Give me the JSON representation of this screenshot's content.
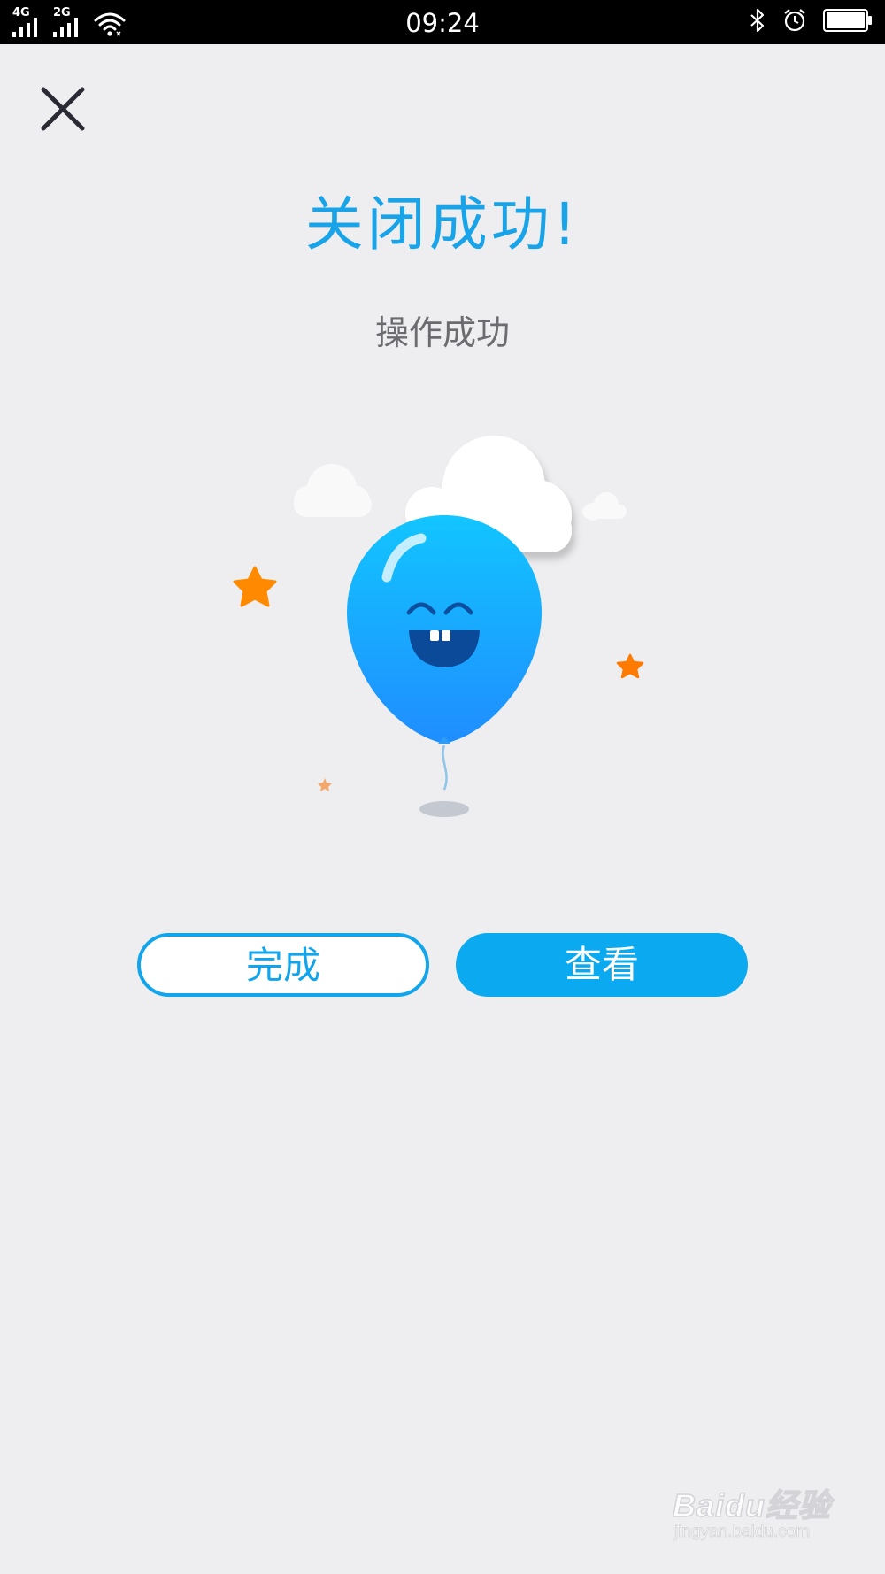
{
  "status_bar": {
    "network_1": "4G",
    "network_2": "2G",
    "time": "09:24",
    "icons": [
      "signal-icon",
      "signal-icon",
      "wifi-icon",
      "bluetooth-icon",
      "alarm-icon",
      "battery-icon"
    ]
  },
  "dialog": {
    "title": "关闭成功!",
    "subtitle": "操作成功",
    "close_icon": "close-icon",
    "illustration": "smiling-balloon-illustration"
  },
  "buttons": {
    "done_label": "完成",
    "view_label": "查看"
  },
  "watermark": {
    "brand": "Baidu经验",
    "url": "jingyan.baidu.com"
  },
  "colors": {
    "accent": "#12a5ec",
    "background": "#eeeef0",
    "star": "#ff8a00"
  }
}
